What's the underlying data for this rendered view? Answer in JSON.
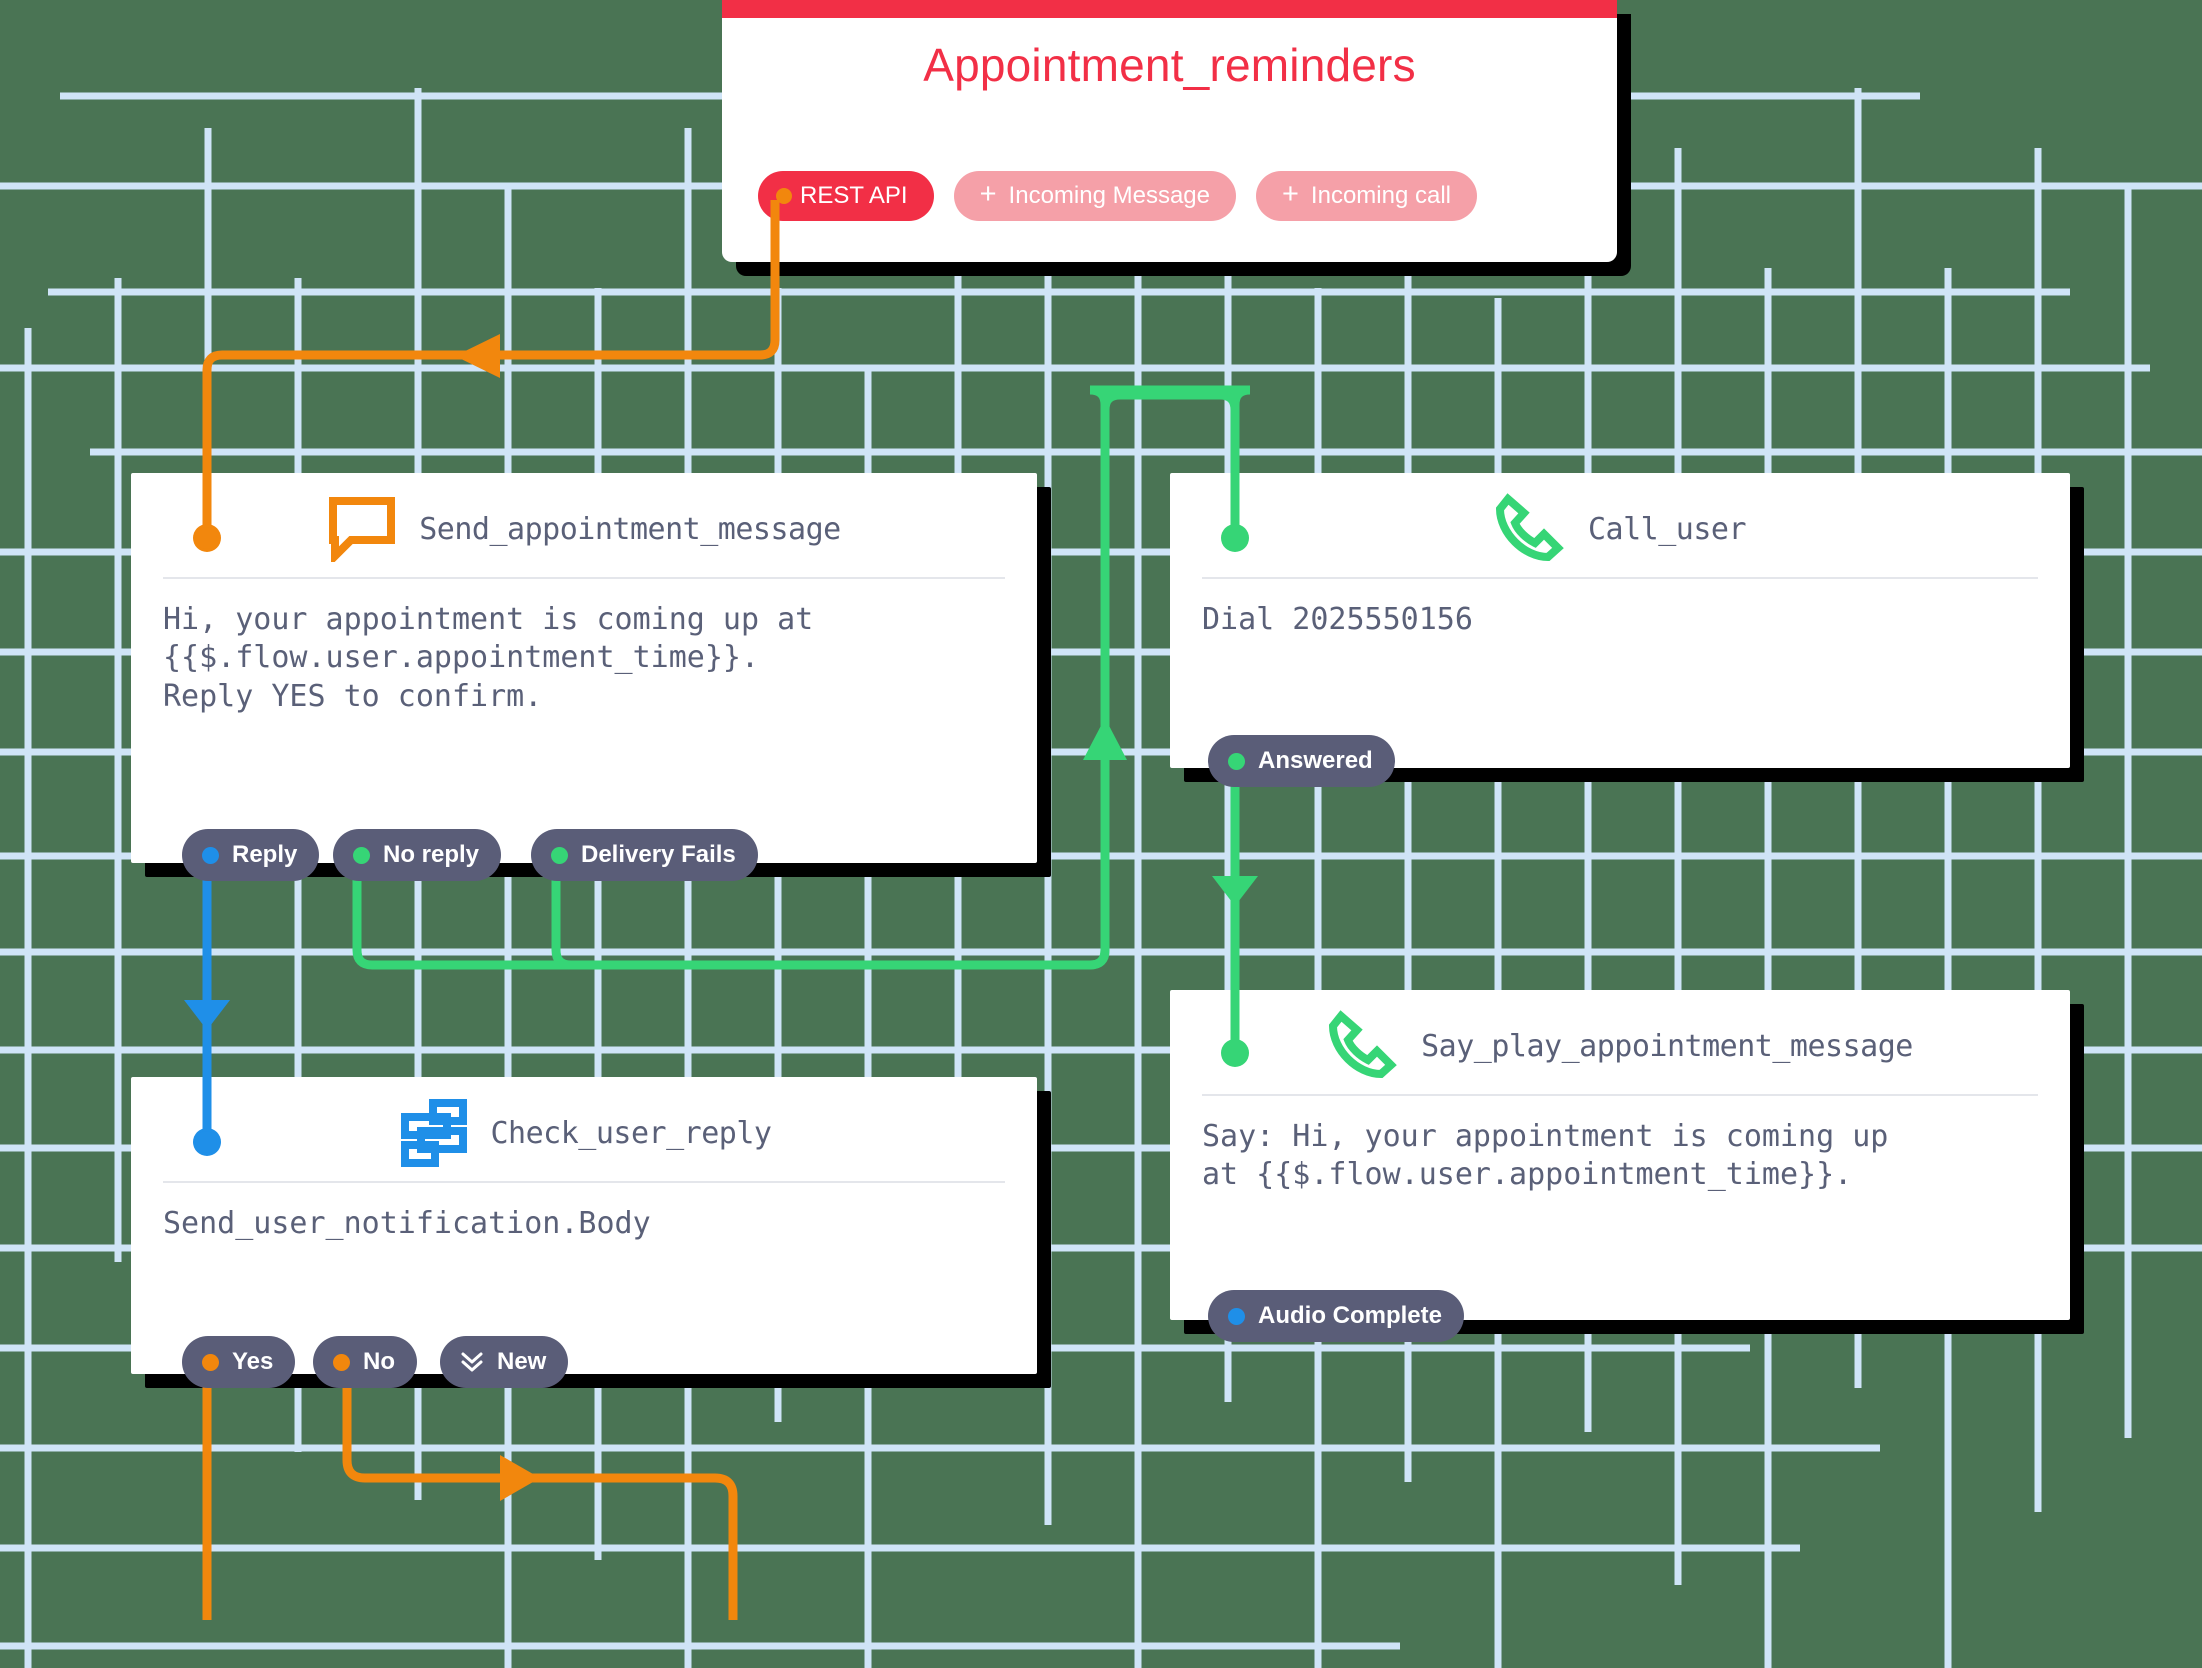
{
  "canvas": {
    "background_color": "#4a7454",
    "grid_line_color": "#cfe4f7"
  },
  "colors": {
    "red": "#f22f46",
    "red_light": "#f5a0a8",
    "orange": "#f2870d",
    "green": "#36d576",
    "blue": "#1f8fe8",
    "pill_bg": "#5a5d78",
    "text": "#5a6078"
  },
  "trigger": {
    "title": "Appointment_reminders",
    "chips": [
      {
        "label": "REST API",
        "style": "primary",
        "icon": "dot-orange"
      },
      {
        "label": "Incoming Message",
        "style": "ghost",
        "icon": "plus-icon"
      },
      {
        "label": "Incoming call",
        "style": "ghost",
        "icon": "plus-icon"
      }
    ]
  },
  "nodes": [
    {
      "id": "send_appointment_message",
      "title": "Send_appointment_message",
      "icon": "chat-bubble-icon",
      "icon_color": "#f2870d",
      "body": "Hi, your appointment is coming up at\n{{$.flow.user.appointment_time}}.\nReply YES to confirm.",
      "in_handle_color": "#f2870d",
      "exits": [
        {
          "label": "Reply",
          "dot_color": "#1f8fe8"
        },
        {
          "label": "No reply",
          "dot_color": "#36d576"
        },
        {
          "label": "Delivery Fails",
          "dot_color": "#36d576"
        }
      ]
    },
    {
      "id": "call_user",
      "title": "Call_user",
      "icon": "phone-icon",
      "icon_color": "#36d576",
      "body": "Dial 2025550156",
      "in_handle_color": "#36d576",
      "exits": [
        {
          "label": "Answered",
          "dot_color": "#36d576"
        }
      ]
    },
    {
      "id": "check_user_reply",
      "title": "Check_user_reply",
      "icon": "split-branch-icon",
      "icon_color": "#1f8fe8",
      "body": "Send_user_notification.Body",
      "in_handle_color": "#1f8fe8",
      "exits": [
        {
          "label": "Yes",
          "dot_color": "#f2870d"
        },
        {
          "label": "No",
          "dot_color": "#f2870d"
        },
        {
          "label": "New",
          "dot_color": null,
          "icon": "chevron-double-down-icon"
        }
      ]
    },
    {
      "id": "say_play_appointment_message",
      "title": "Say_play_appointment_message",
      "icon": "phone-icon",
      "icon_color": "#36d576",
      "body": "Say: Hi, your appointment is coming up\nat {{$.flow.user.appointment_time}}.",
      "in_handle_color": "#36d576",
      "exits": [
        {
          "label": "Audio Complete",
          "dot_color": "#1f8fe8"
        }
      ]
    }
  ],
  "edges": [
    {
      "from": "REST API",
      "to": "Send_appointment_message",
      "color": "#f2870d"
    },
    {
      "from": "Reply",
      "to": "Check_user_reply",
      "color": "#1f8fe8"
    },
    {
      "from": "No reply",
      "to": "Call_user",
      "color": "#36d576"
    },
    {
      "from": "Delivery Fails",
      "to": "Call_user",
      "color": "#36d576"
    },
    {
      "from": "Answered",
      "to": "Say_play_appointment_message",
      "color": "#36d576"
    },
    {
      "from": "Yes",
      "to": null,
      "color": "#f2870d"
    },
    {
      "from": "No",
      "to": null,
      "color": "#f2870d"
    }
  ]
}
